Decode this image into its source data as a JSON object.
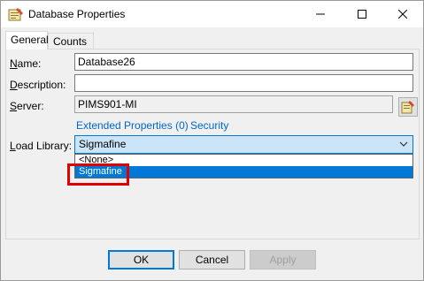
{
  "window": {
    "title": "Database Properties",
    "icon": "database-properties-icon"
  },
  "titlebar": {
    "minimize": "—",
    "maximize": "☐",
    "close": "✕"
  },
  "tabs": [
    {
      "label": "General",
      "active": true
    },
    {
      "label": "Counts",
      "active": false
    }
  ],
  "form": {
    "name": {
      "label_u": "N",
      "label_rest": "ame:",
      "value": "Database26"
    },
    "description": {
      "label_u": "D",
      "label_rest": "escription:",
      "value": ""
    },
    "server": {
      "label_u": "S",
      "label_rest": "erver:",
      "value": "PIMS901-MI"
    },
    "links": {
      "extended": "Extended Properties (0)",
      "security": "Security"
    },
    "load_library": {
      "label_u": "L",
      "label_rest": "oad Library:",
      "value": "Sigmafine",
      "options": [
        "<None>",
        "Sigmafine"
      ]
    }
  },
  "buttons": {
    "ok": "OK",
    "cancel": "Cancel",
    "apply": "Apply"
  },
  "colors": {
    "accent": "#0078d7",
    "link": "#0066cc",
    "highlight_box": "#e00000"
  }
}
